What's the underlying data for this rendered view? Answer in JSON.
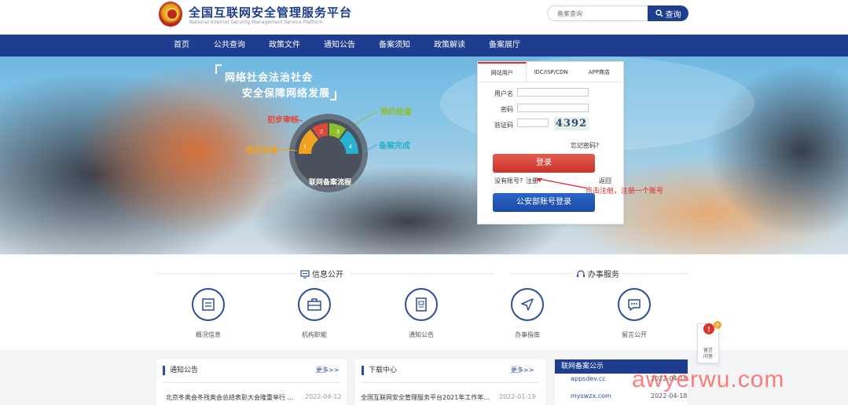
{
  "header": {
    "title": "全国互联网安全管理服务平台",
    "subtitle": "National Internet Security Management Service Platform",
    "search_placeholder": "备案查询",
    "search_button": "查询"
  },
  "nav": [
    "首页",
    "公共查询",
    "政策文件",
    "通知公告",
    "备案须知",
    "政策解读",
    "备案展厅"
  ],
  "banner": {
    "slogan1": "网络社会法治社会",
    "slogan2": "安全保障网络发展",
    "steps": [
      "初步审核",
      "预约检查",
      "提交申请",
      "备案完成"
    ],
    "flow_title": "联网备案流程",
    "colors": {
      "step1": "#e0463a",
      "step2": "#8dbf2d",
      "step3": "#f0a21e",
      "step4": "#2ab0d0"
    }
  },
  "login": {
    "tabs": [
      "网站用户",
      "IDC/ISP/CDN",
      "APP商店"
    ],
    "username_label": "用户名",
    "password_label": "密码",
    "captcha_label": "验证码",
    "captcha_text": "4392",
    "forgot": "忘记密码?",
    "login_button": "登录",
    "no_account": "没有账号?",
    "register": "注册",
    "back": "返回",
    "gongan_button": "公安部账号登录",
    "annotation": "点击注册，注册一个账号"
  },
  "sections": {
    "info_public": "信息公开",
    "services": "办事服务"
  },
  "service_items": [
    "概况信息",
    "机构职能",
    "通知公告",
    "办事指南",
    "留言公开"
  ],
  "notice_panel": {
    "title": "通知公告",
    "more": "更多>>",
    "item_text": "北京冬奥会冬残奥会总结表彰大会隆重举行 ...",
    "item_date": "2022-04-12"
  },
  "download_panel": {
    "title": "下载中心",
    "more": "更多>>",
    "item_text": "全国互联网安全管理服务平台2021年工作年...",
    "item_date": "2022-01-19"
  },
  "beian_panel": {
    "title": "联网备案公示",
    "rows": [
      {
        "domain": "appsdev.cc",
        "date": "2022-04-18"
      },
      {
        "domain": "myswzx.com",
        "date": "2022-04-18"
      }
    ]
  },
  "float_widget": {
    "label_line1": "留言",
    "label_line2": "问答"
  },
  "watermark": "awyerwu.com"
}
